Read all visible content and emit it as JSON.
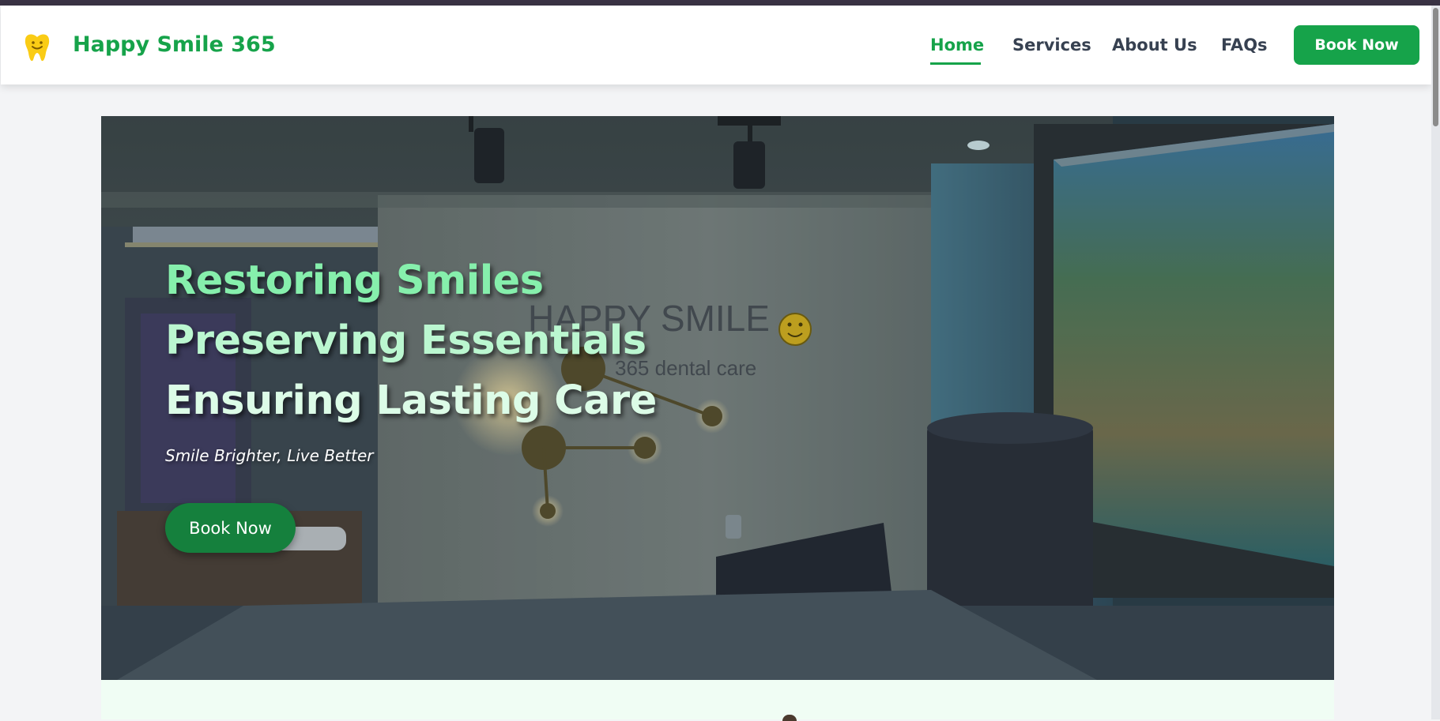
{
  "brand": {
    "name": "Happy Smile 365",
    "logo_icon": "tooth-smile-icon"
  },
  "nav": {
    "items": [
      {
        "label": "Home",
        "active": true
      },
      {
        "label": "Services",
        "active": false
      },
      {
        "label": "About Us",
        "active": false
      },
      {
        "label": "FAQs",
        "active": false
      }
    ],
    "cta_label": "Book Now"
  },
  "hero": {
    "title_lines": [
      "Restoring Smiles",
      "Preserving Essentials",
      "Ensuring Lasting Care"
    ],
    "tagline": "Smile Brighter, Live Better",
    "cta_label": "Book Now",
    "sign_text": "HAPPY SMILE",
    "sign_subtext": "365 dental care"
  },
  "colors": {
    "brand_green": "#16a34a",
    "dark_green": "#15803d",
    "nav_text": "#374151",
    "logo_yellow": "#facc15"
  }
}
